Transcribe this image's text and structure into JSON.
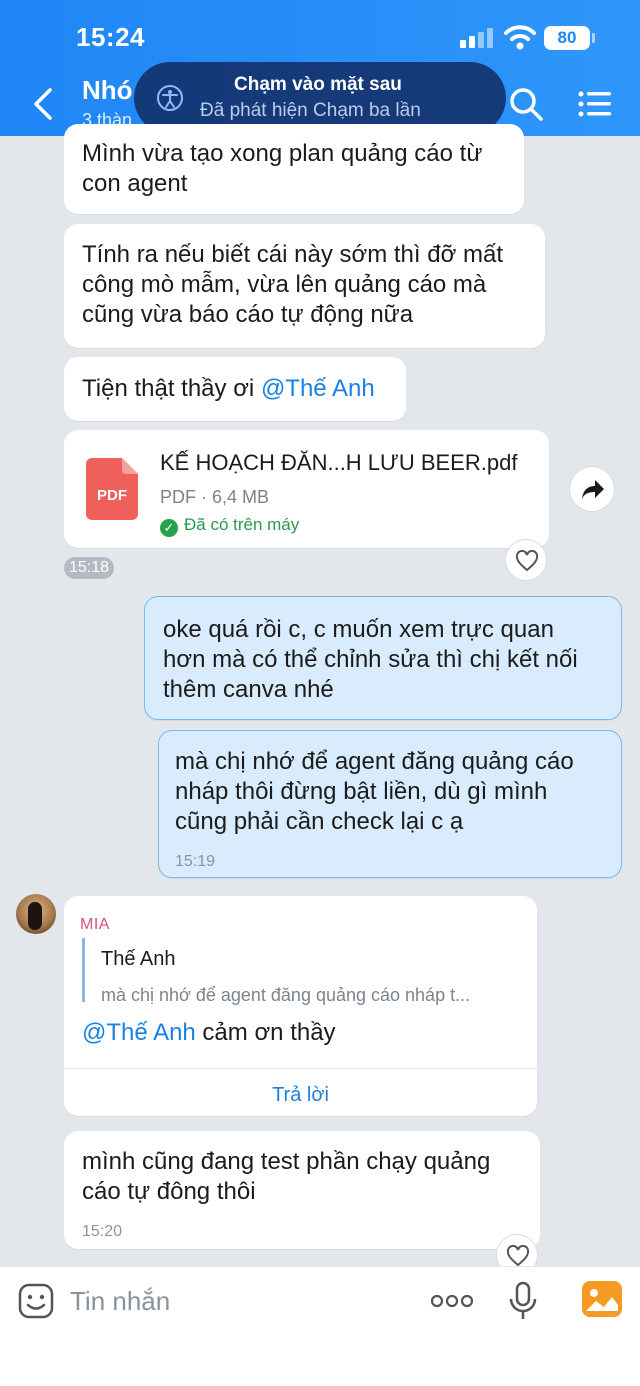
{
  "status_bar": {
    "time": "15:24",
    "battery": "80"
  },
  "header": {
    "title": "Nhó",
    "subtitle": "3 thàn"
  },
  "toast": {
    "title": "Chạm vào mặt sau",
    "subtitle": "Đã phát hiện Chạm ba lần"
  },
  "messages": {
    "m1": {
      "line1": "Mình vừa tạo xong plan quảng cáo từ",
      "line2": "con agent"
    },
    "m2": {
      "line1": "Tính ra nếu biết cái này sớm thì đỡ mất",
      "line2": "công mò mẫm, vừa lên quảng cáo mà",
      "line3": "cũng vừa báo cáo tự động nữa"
    },
    "m3": {
      "text": "Tiện thật thầy ơi ",
      "mention": "@Thế Anh"
    },
    "file": {
      "name": "KẾ HOẠCH ĐĂN...H LƯU BEER.pdf",
      "meta": "PDF · 6,4 MB",
      "status": "Đã có trên máy",
      "icon_label": "PDF",
      "icon_color": "#f0605a"
    },
    "time_pill": "15:18",
    "m4": {
      "line1": "oke quá rồi c, c muốn xem trực quan",
      "line2": "hơn mà có thể chỉnh sửa thì chị kết nối",
      "line3": "thêm canva nhé"
    },
    "m5": {
      "line1": "mà chị nhớ để agent đăng quảng cáo",
      "line2": "nháp thôi đừng bật liền, dù gì mình",
      "line3": "cũng phải cần check lại c ạ",
      "time": "15:19"
    },
    "m6": {
      "sender": "MIA",
      "quote_author": "Thế Anh",
      "quote_text": "mà chị nhớ để agent đăng quảng cáo nháp t...",
      "mention": "@Thế Anh",
      "text": " cảm ơn thầy",
      "reply_label": "Trả lời"
    },
    "m7": {
      "line1": "mình cũng đang test phần chạy quảng",
      "line2": "cáo tự đông thôi",
      "time": "15:20"
    }
  },
  "input": {
    "placeholder": "Tin nhắn"
  },
  "colors": {
    "header": "#1f86f5",
    "my_bubble": "#d8ecfd",
    "accent": "#1a80e6"
  }
}
